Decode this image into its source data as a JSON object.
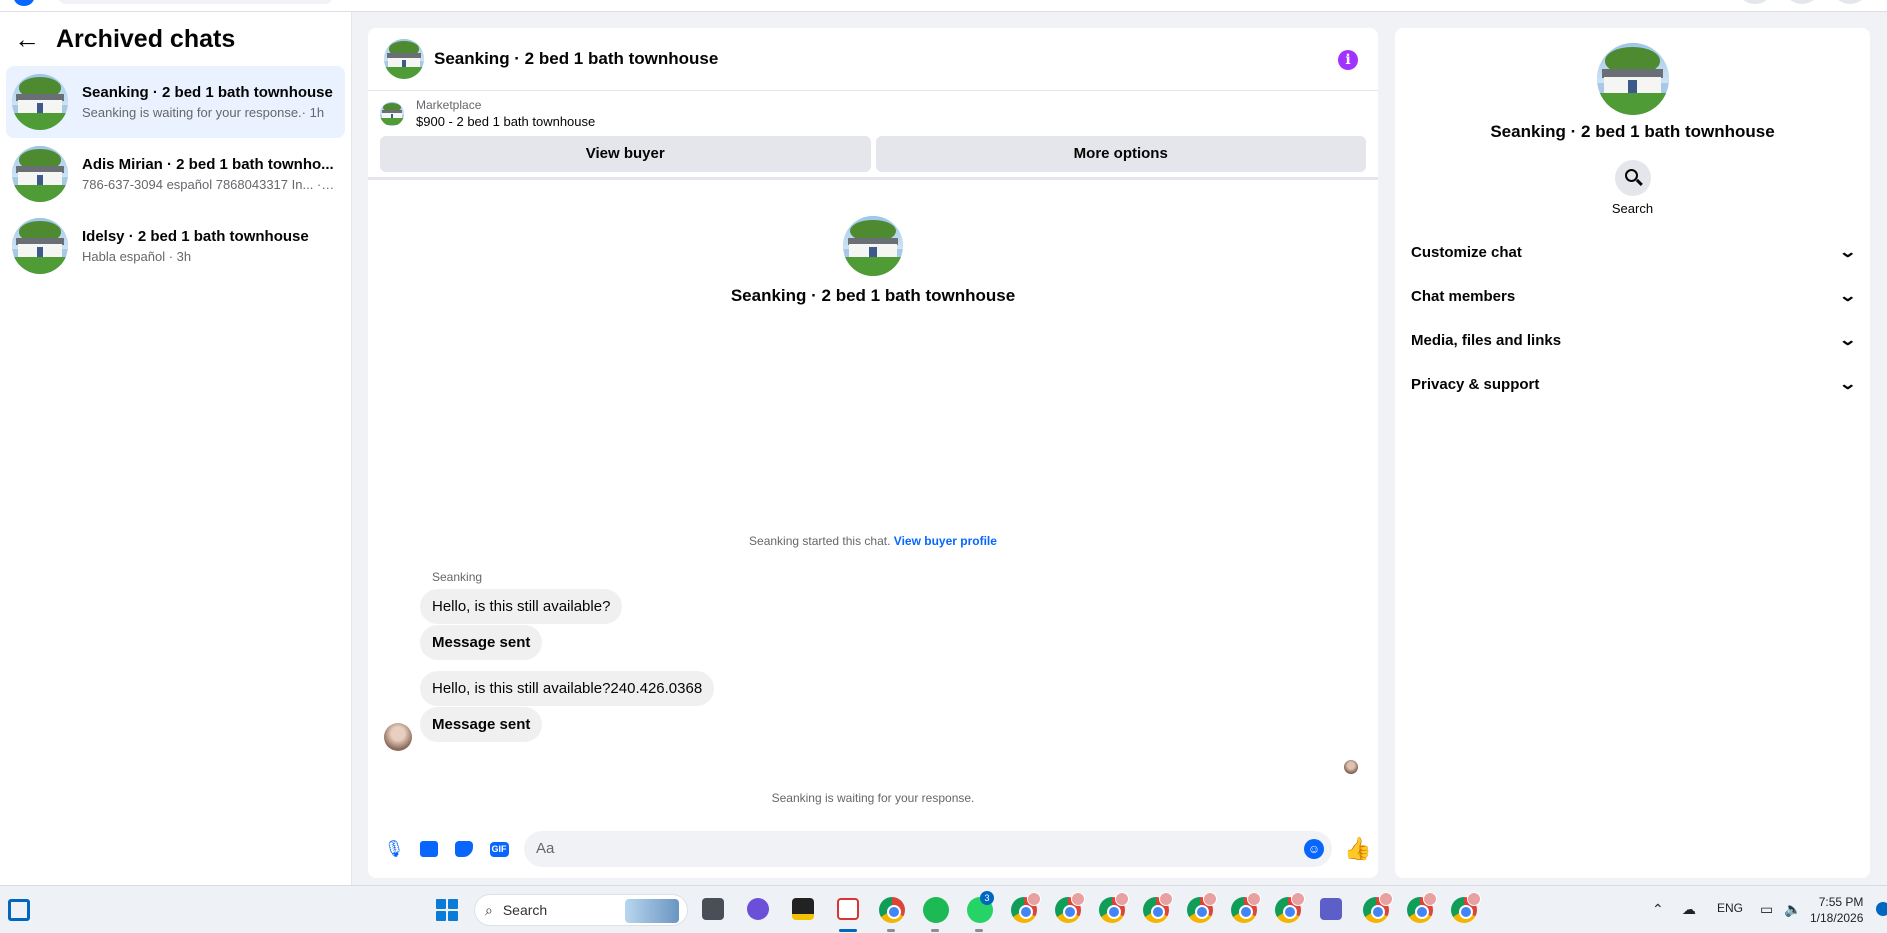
{
  "sidebar": {
    "title": "Archived chats",
    "chats": [
      {
        "name": "Seanking · 2 bed 1 bath townhouse",
        "preview": "Seanking is waiting for your response.· 1h"
      },
      {
        "name": "Adis Mirian · 2 bed 1 bath townho...",
        "preview": "786-637-3094 español 7868043317 In... · 2h"
      },
      {
        "name": "Idelsy · 2 bed 1 bath townhouse",
        "preview": "Habla español · 3h"
      }
    ]
  },
  "conversation": {
    "title": "Seanking · 2 bed 1 bath townhouse",
    "marketplace": {
      "label": "Marketplace",
      "listing": "$900 - 2 bed 1 bath townhouse",
      "view_buyer": "View buyer",
      "more_options": "More options"
    },
    "intro_name": "Seanking · 2 bed 1 bath townhouse",
    "started_text": "Seanking started this chat.",
    "view_profile_link": "View buyer profile",
    "sender_name": "Seanking",
    "messages": [
      {
        "text": "Hello, is this still available?"
      },
      {
        "text": "Message sent"
      },
      {
        "text": "Hello, is this still available?240.426.0368"
      },
      {
        "text": "Message sent"
      }
    ],
    "waiting_text": "Seanking is waiting for your response.",
    "composer_placeholder": "Aa",
    "composer_icons": [
      "microphone-icon",
      "photo-icon",
      "sticker-icon",
      "gif-icon",
      "emoji-icon",
      "thumbs-up-icon"
    ],
    "gif_label": "GIF"
  },
  "details": {
    "name": "Seanking · 2 bed 1 bath townhouse",
    "search_label": "Search",
    "sections": [
      "Customize chat",
      "Chat members",
      "Media, files and links",
      "Privacy & support"
    ]
  },
  "taskbar": {
    "search_label": "Search",
    "whatsapp_badge": "3",
    "language": "ENG",
    "time": "7:55 PM",
    "date": "1/18/2026"
  },
  "colors": {
    "accent": "#0866ff",
    "info_purple": "#a033ff",
    "active_chat_bg": "#e9f2fe"
  }
}
